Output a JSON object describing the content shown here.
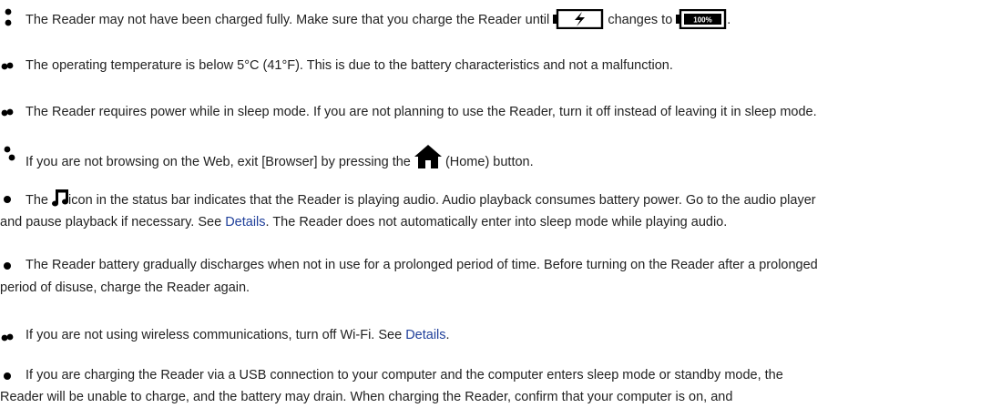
{
  "items": [
    {
      "bullet": "dots-icon",
      "before": "The Reader may not have been charged fully. Make sure that you charge the Reader until",
      "middle": "changes to",
      "after": "."
    },
    {
      "bullet": "dots-icon",
      "text": "The operating temperature is below 5°C (41°F). This is due to the battery characteristics and not a malfunction."
    },
    {
      "bullet": "dots-icon",
      "text": "The Reader requires power while in sleep mode. If you are not planning to use the Reader, turn it off instead of leaving it in sleep mode."
    },
    {
      "bullet": "dots-icon",
      "before": "If you are not browsing on the Web, exit [Browser] by pressing the",
      "after": "(Home) button."
    },
    {
      "bullet": "dot-icon",
      "before": "The",
      "middle": "icon in the status bar indicates that the Reader is playing audio. Audio playback consumes battery power. Go to the audio player",
      "line2_before": "and pause playback if necessary. See",
      "link": "Details",
      "line2_after": ". The Reader does not automatically enter into sleep mode while playing audio."
    },
    {
      "bullet": "dot-icon",
      "line1": "The Reader battery gradually discharges when not in use for a prolonged period of time. Before turning on the Reader after a prolonged",
      "line2": "period of disuse, charge the Reader again."
    },
    {
      "bullet": "dots-icon",
      "before": "If you are not using wireless communications, turn off Wi-Fi. See",
      "link": "Details",
      "after": "."
    },
    {
      "bullet": "dot-icon",
      "line1": "If you are charging the Reader via a USB connection to your computer and the computer enters sleep mode or standby mode, the",
      "line2": "Reader will be unable to charge, and the battery may drain. When charging the Reader, confirm that your computer is on, and"
    }
  ],
  "battery_full_label": "100%",
  "colors": {
    "text": "#222222",
    "link": "#1f3f9a",
    "icon": "#000000"
  }
}
